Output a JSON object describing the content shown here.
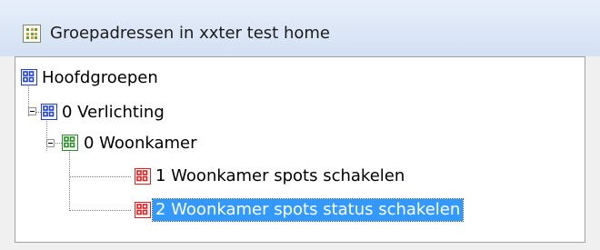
{
  "window": {
    "title": "Groepadressen in xxter test home",
    "icon": "address-grid-icon"
  },
  "tree": {
    "nodes": [
      {
        "label": "Hoofdgroepen",
        "icon": "main-group-icon",
        "color": "#1f3fd6",
        "level": 0,
        "expanded": true
      },
      {
        "label": "0 Verlichting",
        "icon": "main-group-icon",
        "color": "#1f3fd6",
        "level": 1,
        "expanded": true
      },
      {
        "label": "0 Woonkamer",
        "icon": "middle-group-icon",
        "color": "#2a8a2a",
        "level": 2,
        "expanded": true
      },
      {
        "label": "1 Woonkamer spots schakelen",
        "icon": "group-address-icon",
        "color": "#e02020",
        "level": 3,
        "selected": false
      },
      {
        "label": "2 Woonkamer spots status schakelen",
        "icon": "group-address-icon",
        "color": "#e02020",
        "level": 3,
        "selected": true
      }
    ],
    "selection_color": "#3399ff"
  }
}
